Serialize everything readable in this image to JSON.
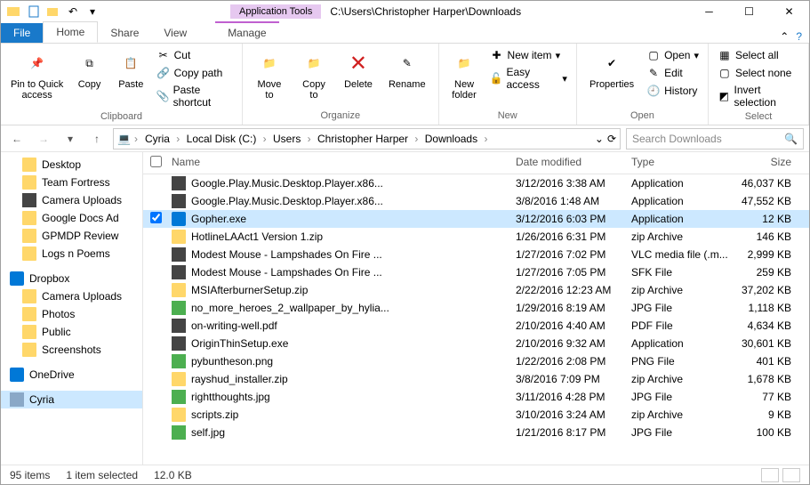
{
  "window": {
    "title": "C:\\Users\\Christopher Harper\\Downloads",
    "app_tools_label": "Application Tools"
  },
  "tabs": {
    "file": "File",
    "home": "Home",
    "share": "Share",
    "view": "View",
    "manage": "Manage"
  },
  "ribbon": {
    "clipboard": {
      "title": "Clipboard",
      "pin": "Pin to Quick\naccess",
      "copy": "Copy",
      "paste": "Paste",
      "cut": "Cut",
      "copypath": "Copy path",
      "pasteshortcut": "Paste shortcut"
    },
    "organize": {
      "title": "Organize",
      "moveto": "Move\nto",
      "copyto": "Copy\nto",
      "delete": "Delete",
      "rename": "Rename"
    },
    "new": {
      "title": "New",
      "newfolder": "New\nfolder",
      "newitem": "New item",
      "easyaccess": "Easy access"
    },
    "open": {
      "title": "Open",
      "properties": "Properties",
      "open": "Open",
      "edit": "Edit",
      "history": "History"
    },
    "select": {
      "title": "Select",
      "selectall": "Select all",
      "selectnone": "Select none",
      "invert": "Invert selection"
    }
  },
  "breadcrumbs": [
    "Cyria",
    "Local Disk (C:)",
    "Users",
    "Christopher Harper",
    "Downloads"
  ],
  "search": {
    "placeholder": "Search Downloads"
  },
  "tree": {
    "quick": [
      {
        "label": "Desktop",
        "cls": "f-folder"
      },
      {
        "label": "Team Fortress",
        "cls": "f-folder"
      },
      {
        "label": "Camera Uploads",
        "cls": "f-dark"
      },
      {
        "label": "Google Docs Ad",
        "cls": "f-folder"
      },
      {
        "label": "GPMDP Review",
        "cls": "f-folder"
      },
      {
        "label": "Logs n Poems",
        "cls": "f-folder"
      }
    ],
    "dropbox": {
      "label": "Dropbox",
      "items": [
        {
          "label": "Camera Uploads",
          "cls": "f-folder"
        },
        {
          "label": "Photos",
          "cls": "f-folder"
        },
        {
          "label": "Public",
          "cls": "f-folder"
        },
        {
          "label": "Screenshots",
          "cls": "f-folder"
        }
      ]
    },
    "onedrive": {
      "label": "OneDrive"
    },
    "pc": {
      "label": "Cyria"
    }
  },
  "columns": {
    "name": "Name",
    "date": "Date modified",
    "type": "Type",
    "size": "Size"
  },
  "files": [
    {
      "icon": "f-dark",
      "name": "Google.Play.Music.Desktop.Player.x86...",
      "date": "3/12/2016 3:38 AM",
      "type": "Application",
      "size": "46,037 KB",
      "sel": false
    },
    {
      "icon": "f-dark",
      "name": "Google.Play.Music.Desktop.Player.x86...",
      "date": "3/8/2016 1:48 AM",
      "type": "Application",
      "size": "47,552 KB",
      "sel": false
    },
    {
      "icon": "f-blue",
      "name": "Gopher.exe",
      "date": "3/12/2016 6:03 PM",
      "type": "Application",
      "size": "12 KB",
      "sel": true
    },
    {
      "icon": "f-folder",
      "name": "HotlineLAAct1 Version 1.zip",
      "date": "1/26/2016 6:31 PM",
      "type": "zip Archive",
      "size": "146 KB",
      "sel": false
    },
    {
      "icon": "f-dark",
      "name": "Modest Mouse - Lampshades On Fire ...",
      "date": "1/27/2016 7:02 PM",
      "type": "VLC media file (.m...",
      "size": "2,999 KB",
      "sel": false
    },
    {
      "icon": "f-dark",
      "name": "Modest Mouse - Lampshades On Fire ...",
      "date": "1/27/2016 7:05 PM",
      "type": "SFK File",
      "size": "259 KB",
      "sel": false
    },
    {
      "icon": "f-folder",
      "name": "MSIAfterburnerSetup.zip",
      "date": "2/22/2016 12:23 AM",
      "type": "zip Archive",
      "size": "37,202 KB",
      "sel": false
    },
    {
      "icon": "f-green",
      "name": "no_more_heroes_2_wallpaper_by_hylia...",
      "date": "1/29/2016 8:19 AM",
      "type": "JPG File",
      "size": "1,118 KB",
      "sel": false
    },
    {
      "icon": "f-dark",
      "name": "on-writing-well.pdf",
      "date": "2/10/2016 4:40 AM",
      "type": "PDF File",
      "size": "4,634 KB",
      "sel": false
    },
    {
      "icon": "f-dark",
      "name": "OriginThinSetup.exe",
      "date": "2/10/2016 9:32 AM",
      "type": "Application",
      "size": "30,601 KB",
      "sel": false
    },
    {
      "icon": "f-green",
      "name": "pybuntheson.png",
      "date": "1/22/2016 2:08 PM",
      "type": "PNG File",
      "size": "401 KB",
      "sel": false
    },
    {
      "icon": "f-folder",
      "name": "rayshud_installer.zip",
      "date": "3/8/2016 7:09 PM",
      "type": "zip Archive",
      "size": "1,678 KB",
      "sel": false
    },
    {
      "icon": "f-green",
      "name": "rightthoughts.jpg",
      "date": "3/11/2016 4:28 PM",
      "type": "JPG File",
      "size": "77 KB",
      "sel": false
    },
    {
      "icon": "f-folder",
      "name": "scripts.zip",
      "date": "3/10/2016 3:24 AM",
      "type": "zip Archive",
      "size": "9 KB",
      "sel": false
    },
    {
      "icon": "f-green",
      "name": "self.jpg",
      "date": "1/21/2016 8:17 PM",
      "type": "JPG File",
      "size": "100 KB",
      "sel": false
    }
  ],
  "status": {
    "count": "95 items",
    "selected": "1 item selected",
    "size": "12.0 KB"
  }
}
